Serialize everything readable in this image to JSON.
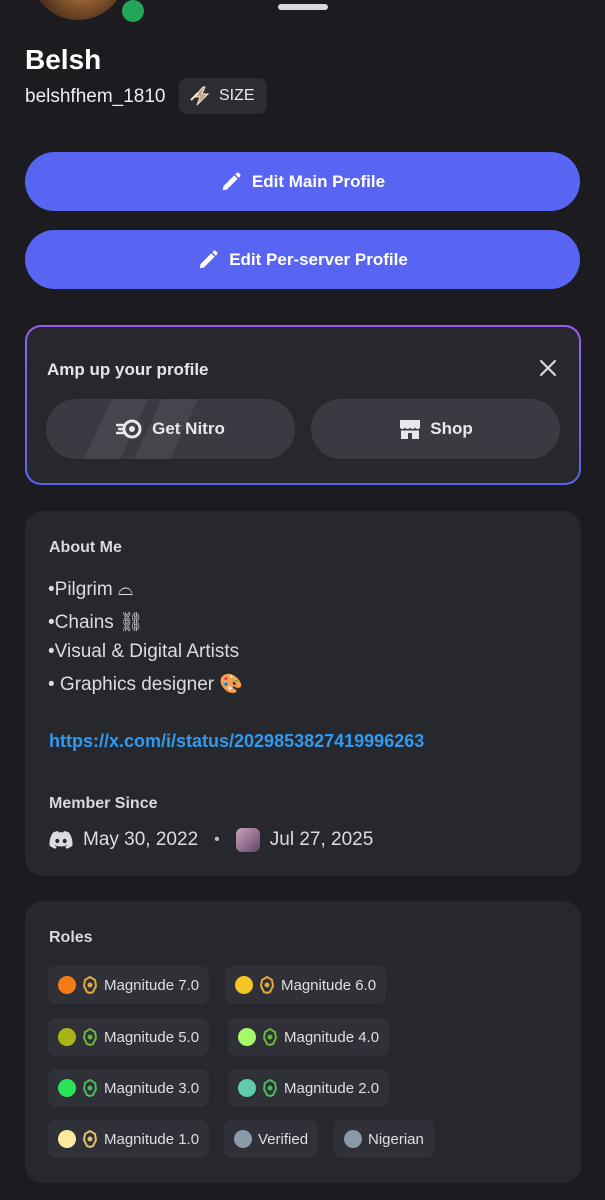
{
  "profile": {
    "display_name": "Belsh",
    "username": "belshfhem_1810",
    "tag_label": "SIZE",
    "status_color": "#23a55a"
  },
  "buttons": {
    "edit_main": "Edit Main Profile",
    "edit_server": "Edit Per-server Profile",
    "accent_color": "#5865f2"
  },
  "amp": {
    "title": "Amp up your profile",
    "nitro_label": "Get Nitro",
    "shop_label": "Shop"
  },
  "about": {
    "title": "About Me",
    "lines": [
      "•Pilgrim ⌓",
      "•Chains ⛓",
      "•Visual & Digital Artists",
      "• Graphics designer 🎨"
    ],
    "link": "https://x.com/i/status/2029853827419996263",
    "link_color": "#2e9bf0"
  },
  "member_since": {
    "title": "Member Since",
    "discord_date": "May 30, 2022",
    "separator": "•",
    "server_date": "Jul 27, 2025"
  },
  "roles": {
    "title": "Roles",
    "items": [
      {
        "label": "Magnitude 7.0",
        "color": "#f57c14",
        "emblem": "#e0a93c"
      },
      {
        "label": "Magnitude 6.0",
        "color": "#f3c425",
        "emblem": "#e0a93c"
      },
      {
        "label": "Magnitude 5.0",
        "color": "#a9b517",
        "emblem": "#67b63a"
      },
      {
        "label": "Magnitude 4.0",
        "color": "#a6f76a",
        "emblem": "#67b63a"
      },
      {
        "label": "Magnitude 3.0",
        "color": "#29e35a",
        "emblem": "#4cb85a"
      },
      {
        "label": "Magnitude 2.0",
        "color": "#5fcba8",
        "emblem": "#4cb85a"
      },
      {
        "label": "Magnitude 1.0",
        "color": "#fde9a0",
        "emblem": "#e2c070"
      },
      {
        "label": "Verified",
        "color": "#8a9aa8",
        "emblem": ""
      },
      {
        "label": "Nigerian",
        "color": "#8a9aa8",
        "emblem": ""
      }
    ]
  }
}
